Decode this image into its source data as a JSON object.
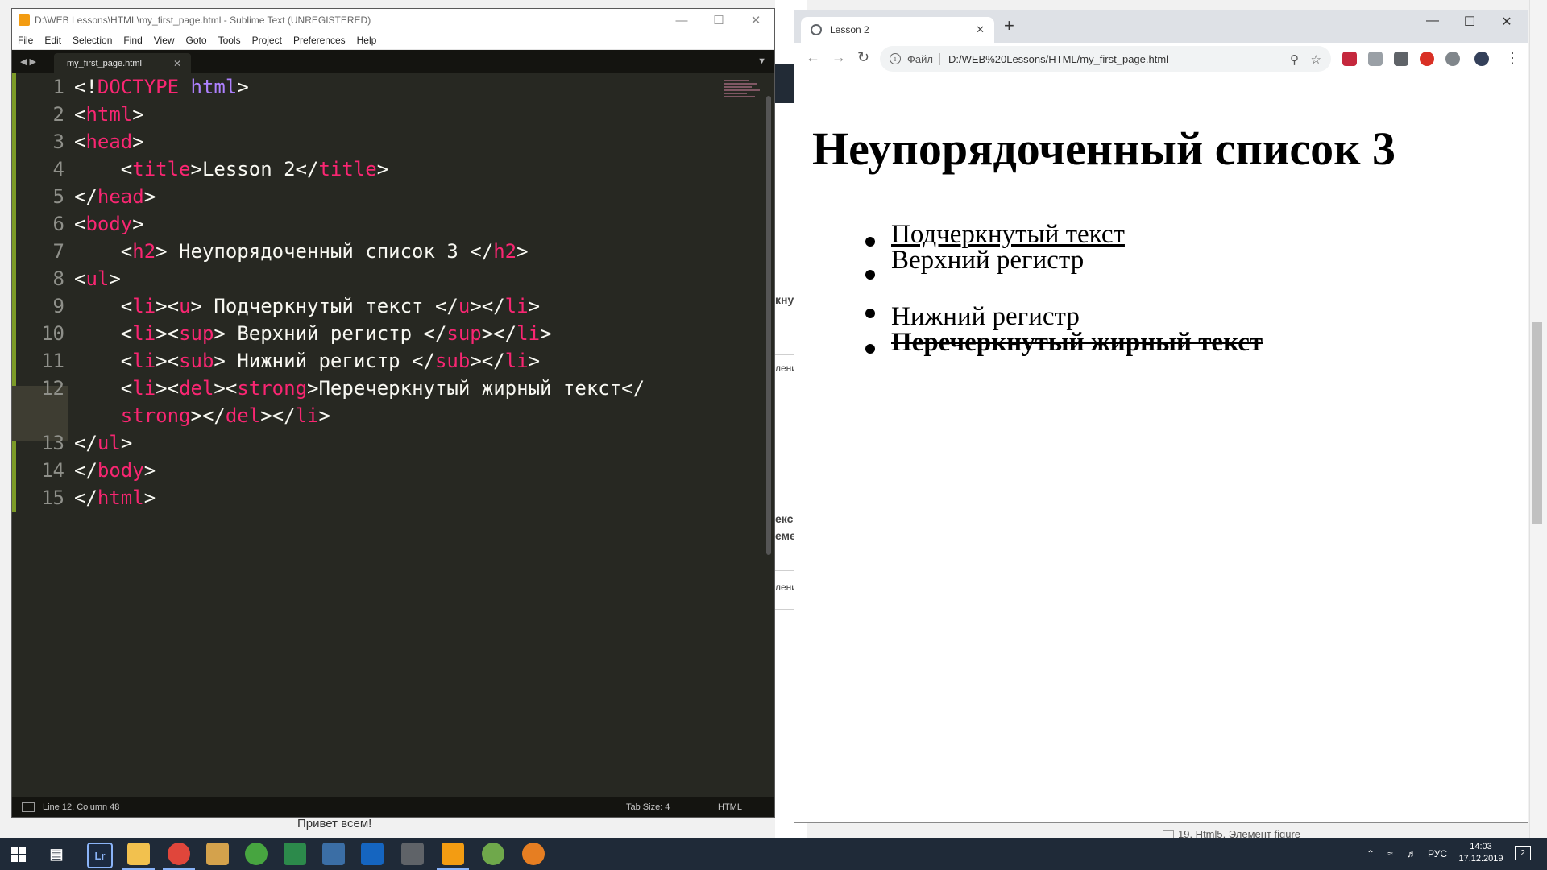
{
  "background": {
    "fragments": [
      "кнут",
      "лени",
      "екс",
      "еме",
      "лени"
    ],
    "bottom_text": "Привет всем!",
    "bottom_item": "19. Html5. Элемент figure"
  },
  "sublime": {
    "title": "D:\\WEB Lessons\\HTML\\my_first_page.html - Sublime Text (UNREGISTERED)",
    "menu": [
      "File",
      "Edit",
      "Selection",
      "Find",
      "View",
      "Goto",
      "Tools",
      "Project",
      "Preferences",
      "Help"
    ],
    "tab_name": "my_first_page.html",
    "lines": [
      "1",
      "2",
      "3",
      "4",
      "5",
      "6",
      "7",
      "8",
      "9",
      "10",
      "11",
      "12",
      "13",
      "14",
      "15"
    ],
    "status_position": "Line 12, Column 48",
    "status_tab_size": "Tab Size: 4",
    "status_syntax": "HTML"
  },
  "chrome": {
    "tab_title": "Lesson 2",
    "address_prefix": "Файл",
    "address": "D:/WEB%20Lessons/HTML/my_first_page.html",
    "heading": "Неупорядоченный список 3",
    "list_items": [
      "Подчеркнутый текст",
      "Верхний регистр",
      "Нижний регистр",
      "Перечеркнутый жирный текст"
    ]
  },
  "taskbar": {
    "language": "РУС",
    "time": "14:03",
    "date": "17.12.2019",
    "notifications": "2"
  }
}
